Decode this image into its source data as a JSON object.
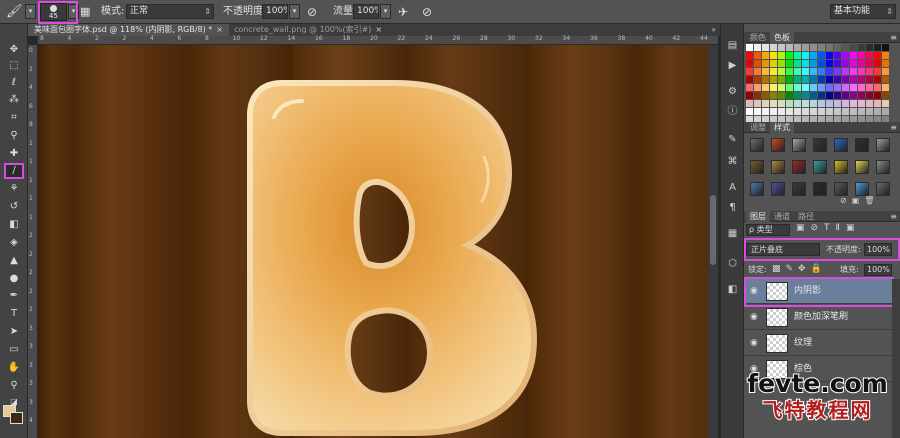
{
  "options_bar": {
    "brush_size": "45",
    "mode_label": "模式:",
    "mode_value": "正常",
    "opacity_label": "不透明度:",
    "opacity_value": "100%",
    "flow_label": "流量:",
    "flow_value": "100%",
    "workspace": "基本功能"
  },
  "document_tabs": [
    {
      "label": "美味面包圈字体.psd @ 118% (内阴影, RGB/8) *",
      "close": "×"
    },
    {
      "label": "concrete_wall.png @ 100%(索引#)",
      "close": "×"
    }
  ],
  "ruler_marks": [
    "8",
    "4",
    "2",
    "2",
    "4",
    "6",
    "8",
    "10",
    "12",
    "14",
    "16",
    "18",
    "20",
    "22",
    "24",
    "26",
    "28",
    "30",
    "32",
    "34",
    "36",
    "38",
    "40",
    "42",
    "44"
  ],
  "foreground_color_annotation": "#e7c793",
  "colors_panel": {
    "tabs": [
      "颜色",
      "色板"
    ]
  },
  "styles_panel": {
    "tabs": [
      "调整",
      "样式"
    ]
  },
  "layers_panel": {
    "tabs": [
      "图层",
      "通道",
      "路径"
    ],
    "filter_label": "ρ 类型",
    "blend_mode": "正片叠底",
    "opacity_label": "不透明度:",
    "opacity_value": "100%",
    "lock_label": "锁定:",
    "fill_label": "填充:",
    "fill_value": "100%",
    "layers": [
      {
        "name": "内阴影",
        "selected": true
      },
      {
        "name": "颜色加深笔刷",
        "selected": false
      },
      {
        "name": "纹理",
        "selected": false
      },
      {
        "name": "棕色",
        "selected": false
      }
    ]
  },
  "watermark": {
    "line1": "fevte.com",
    "line2": "飞特教程网"
  },
  "colors": {
    "highlight": "#d64fdc",
    "selected_layer": "#6a7f9c",
    "foreground_swatch": "#e7c793",
    "background_swatch": "#3a2a10",
    "bread_base": "#e8a850",
    "wood": "#5a3210"
  }
}
